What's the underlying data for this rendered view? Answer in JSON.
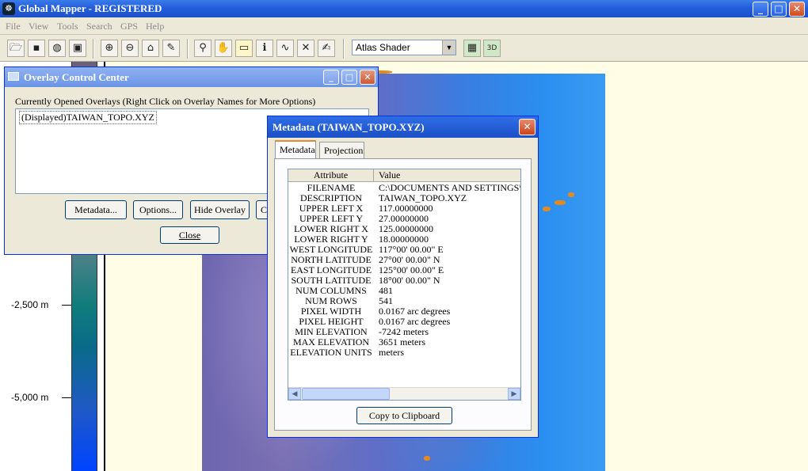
{
  "window": {
    "title": "Global Mapper - REGISTERED",
    "minimize_glyph": "_",
    "maximize_glyph": "□",
    "close_glyph": "✕"
  },
  "menu": [
    "File",
    "View",
    "Tools",
    "Search",
    "GPS",
    "Help"
  ],
  "toolbar": {
    "shader_value": "Atlas Shader",
    "dropdown_glyph": "▼",
    "icons": [
      "open-folder-icon",
      "save-icon",
      "globe-icon",
      "export-icon",
      "zoom-in-icon",
      "zoom-out-icon",
      "home-icon",
      "digitize-icon",
      "zoom-tool-icon",
      "pan-hand-icon",
      "measure-icon",
      "info-icon",
      "path-profile-icon",
      "line-of-sight-icon",
      "edit-icon",
      "shader-render-icon",
      "3d-view-icon"
    ]
  },
  "legend": {
    "labels": [
      "-2,500 m",
      "-5,000 m"
    ]
  },
  "overlay_control": {
    "title": "Overlay Control Center",
    "caption": "Currently Opened Overlays (Right Click on Overlay Names for More Options)",
    "overlays": [
      "(Displayed)TAIWAN_TOPO.XYZ"
    ],
    "buttons": {
      "metadata": "Metadata...",
      "options": "Options...",
      "hide": "Hide Overlay",
      "close_partial": "Cl",
      "close": "Close"
    }
  },
  "metadata_dialog": {
    "title": "Metadata (TAIWAN_TOPO.XYZ)",
    "tabs": [
      "Metadata",
      "Projection"
    ],
    "columns": [
      "Attribute",
      "Value"
    ],
    "rows": [
      {
        "attr": "FILENAME",
        "val": "C:\\DOCUMENTS AND SETTINGS\\C"
      },
      {
        "attr": "DESCRIPTION",
        "val": "TAIWAN_TOPO.XYZ"
      },
      {
        "attr": "UPPER LEFT X",
        "val": "117.00000000"
      },
      {
        "attr": "UPPER LEFT Y",
        "val": "27.00000000"
      },
      {
        "attr": "LOWER RIGHT X",
        "val": "125.00000000"
      },
      {
        "attr": "LOWER RIGHT Y",
        "val": "18.00000000"
      },
      {
        "attr": "WEST LONGITUDE",
        "val": "117°00' 00.00\" E"
      },
      {
        "attr": "NORTH LATITUDE",
        "val": "27°00' 00.00\" N"
      },
      {
        "attr": "EAST LONGITUDE",
        "val": "125°00' 00.00\" E"
      },
      {
        "attr": "SOUTH LATITUDE",
        "val": "18°00' 00.00\" N"
      },
      {
        "attr": "NUM COLUMNS",
        "val": "481"
      },
      {
        "attr": "NUM ROWS",
        "val": "541"
      },
      {
        "attr": "PIXEL WIDTH",
        "val": "0.0167 arc degrees"
      },
      {
        "attr": "PIXEL HEIGHT",
        "val": "0.0167 arc degrees"
      },
      {
        "attr": "MIN ELEVATION",
        "val": "-7242 meters"
      },
      {
        "attr": "MAX ELEVATION",
        "val": "3651 meters"
      },
      {
        "attr": "ELEVATION UNITS",
        "val": "meters"
      }
    ],
    "copy_button": "Copy to Clipboard",
    "close_glyph": "✕"
  }
}
